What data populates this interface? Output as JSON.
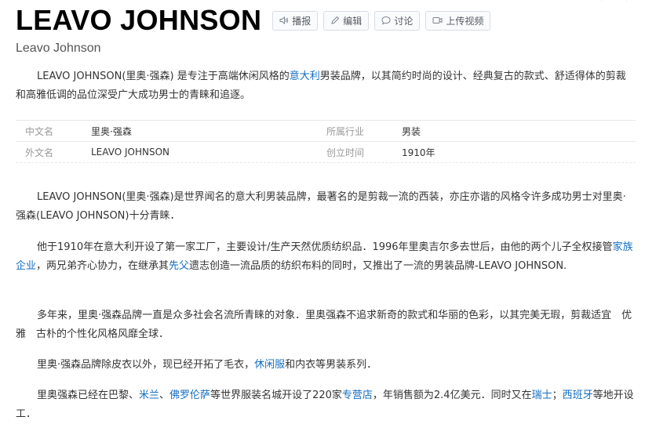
{
  "header": {
    "title": "LEAVO JOHNSON",
    "subtitle": "Leavo Johnson",
    "actions": [
      {
        "label": "播报",
        "icon": "speaker-icon"
      },
      {
        "label": "编辑",
        "icon": "pencil-icon"
      },
      {
        "label": "讨论",
        "icon": "chat-bubble-icon"
      },
      {
        "label": "上传视频",
        "icon": "video-camera-icon"
      }
    ]
  },
  "summary": {
    "part1": "LEAVO JOHNSON(里奥·强森) 是专注于高端休闲风格的",
    "link1": "意大利",
    "part2": "男装品牌，以其简约时尚的设计、经典复古的款式、舒适得体的剪裁和高雅低调的品位深受广大成功男士的青睐和追逐。"
  },
  "info": {
    "rows": [
      {
        "label1": "中文名",
        "value1": "里奥·强森",
        "label2": "所属行业",
        "value2": "男装"
      },
      {
        "label1": "外文名",
        "value1": "LEAVO JOHNSON",
        "label2": "创立时间",
        "value2": "1910年"
      }
    ]
  },
  "body": {
    "p1": "LEAVO JOHNSON(里奥·强森)是世界闻名的意大利男装品牌，最著名的是剪裁一流的西装，亦庄亦谐的风格令许多成功男士对里奥·强森(LEAVO JOHNSON)十分青睐．",
    "p2_a": "他于1910年在意大利开设了第一家工厂，主要设计/生产天然优质纺织品．1996年里奥吉尔多去世后，由他的两个儿子全权接管",
    "p2_link1": "家族企业",
    "p2_b": "，两兄弟齐心协力，在继承其",
    "p2_link2": "先父",
    "p2_c": "遗志创造一流品质的纺织布料的同时，又推出了一流的男装品牌-LEAVO JOHNSON.",
    "p3": "多年来，里奥·强森品牌一直是众多社会名流所青睐的对象．里奥强森不追求新奇的款式和华丽的色彩，以其完美无瑕，剪裁适宜　优雅　古朴的个性化风格风靡全球．",
    "p4_a": "里奥·强森品牌除皮衣以外，现已经开拓了毛衣，",
    "p4_link1": "休闲服",
    "p4_b": "和内衣等男装系列．",
    "p5_a": "里奥强森已经在巴黎、",
    "p5_link1": "米兰",
    "p5_b": "、",
    "p5_link2": "佛罗伦萨",
    "p5_c": "等世界服装名城开设了220家",
    "p5_link3": "专营店",
    "p5_d": "，年销售额为2.4亿美元．同时又在",
    "p5_link4": "瑞士",
    "p5_e": "；",
    "p5_link5": "西班牙",
    "p5_f": "等地开设工．"
  },
  "colors": {
    "link": "#136ec2",
    "text": "#333333",
    "label": "#999999"
  }
}
